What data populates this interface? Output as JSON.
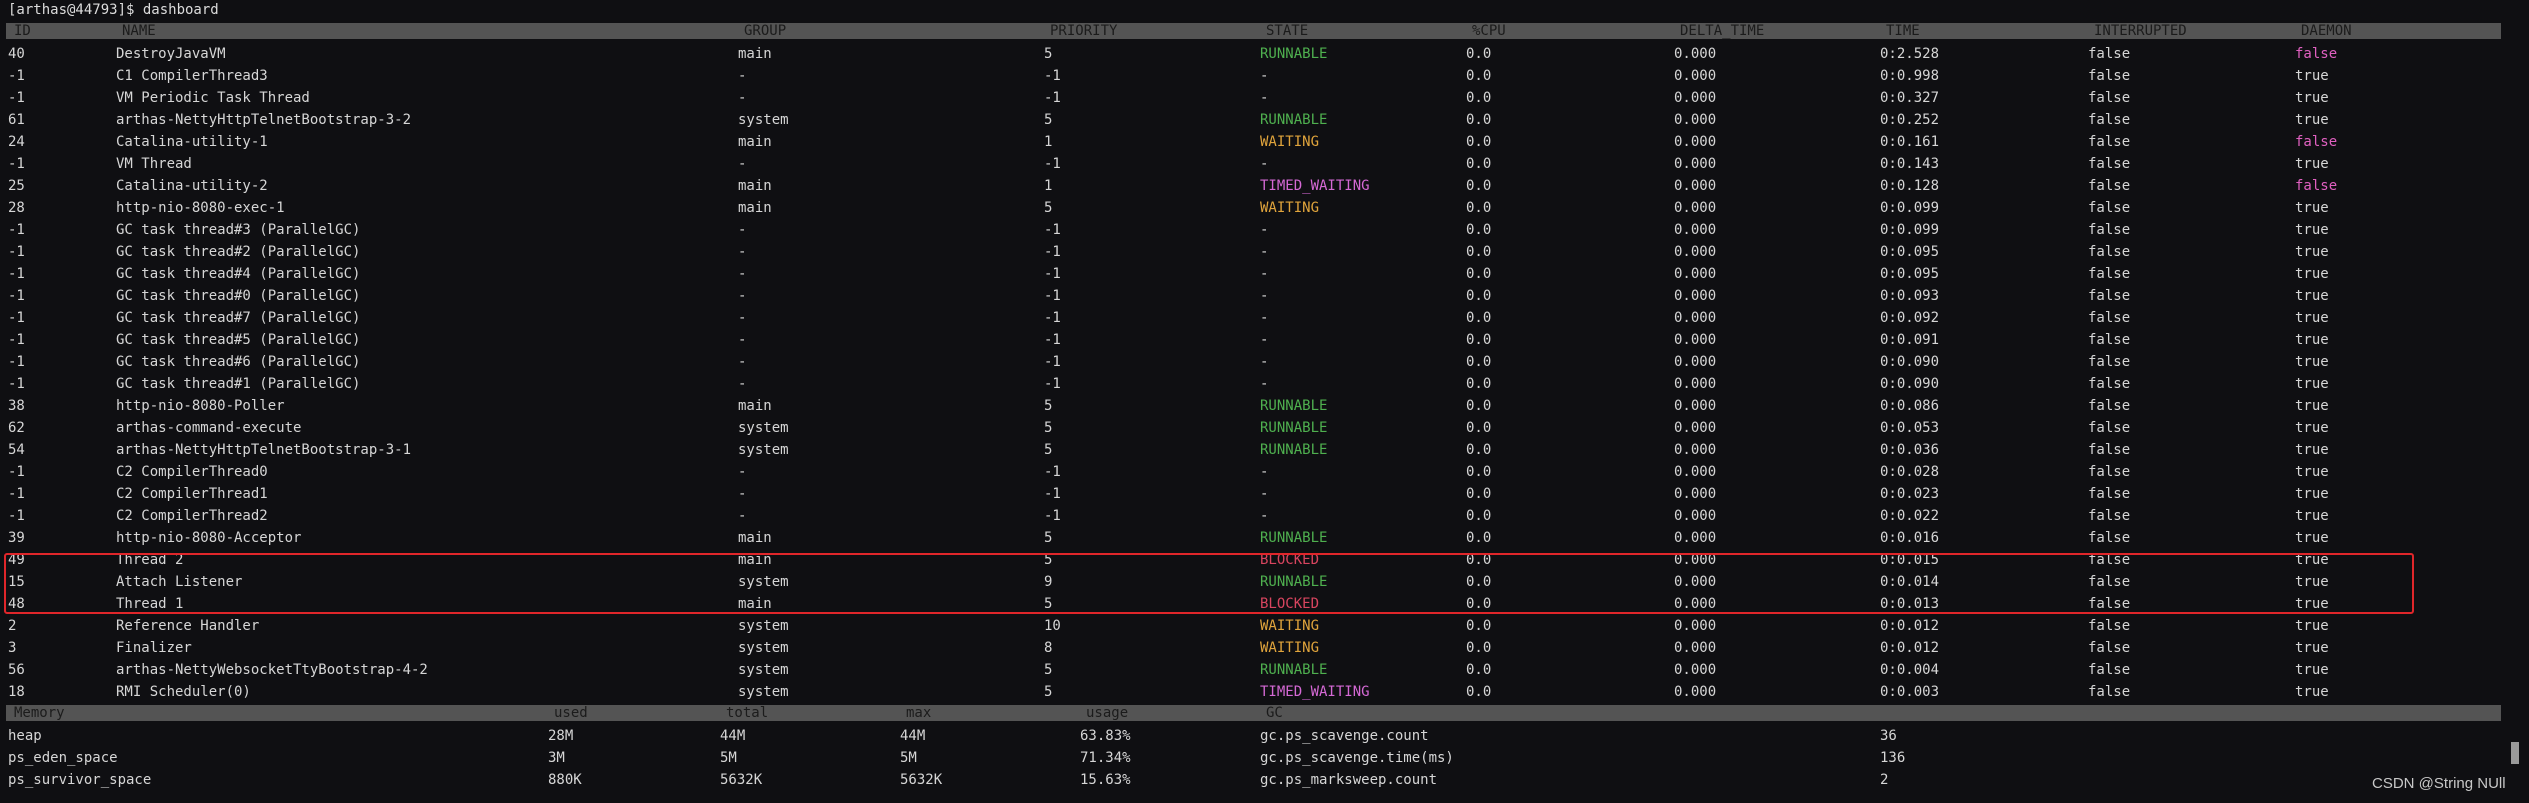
{
  "prompt": "[arthas@44793]$ dashboard",
  "colors": {
    "RUNNABLE": "#4fb04f",
    "WAITING": "#e0a43c",
    "TIMED_WAITING": "#d569d5",
    "BLOCKED": "#d8455f",
    "-": "#d6d6d6",
    "daemon_false": "#e060c0",
    "daemon_true": "#d6d6d6"
  },
  "thread_headers": [
    "ID",
    "NAME",
    "GROUP",
    "PRIORITY",
    "STATE",
    "%CPU",
    "DELTA_TIME",
    "TIME",
    "INTERRUPTED",
    "DAEMON"
  ],
  "threads": [
    [
      "40",
      "DestroyJavaVM",
      "main",
      "5",
      "RUNNABLE",
      "0.0",
      "0.000",
      "0:2.528",
      "false",
      "false"
    ],
    [
      "-1",
      "C1 CompilerThread3",
      "-",
      "-1",
      "-",
      "0.0",
      "0.000",
      "0:0.998",
      "false",
      "true"
    ],
    [
      "-1",
      "VM Periodic Task Thread",
      "-",
      "-1",
      "-",
      "0.0",
      "0.000",
      "0:0.327",
      "false",
      "true"
    ],
    [
      "61",
      "arthas-NettyHttpTelnetBootstrap-3-2",
      "system",
      "5",
      "RUNNABLE",
      "0.0",
      "0.000",
      "0:0.252",
      "false",
      "true"
    ],
    [
      "24",
      "Catalina-utility-1",
      "main",
      "1",
      "WAITING",
      "0.0",
      "0.000",
      "0:0.161",
      "false",
      "false"
    ],
    [
      "-1",
      "VM Thread",
      "-",
      "-1",
      "-",
      "0.0",
      "0.000",
      "0:0.143",
      "false",
      "true"
    ],
    [
      "25",
      "Catalina-utility-2",
      "main",
      "1",
      "TIMED_WAITING",
      "0.0",
      "0.000",
      "0:0.128",
      "false",
      "false"
    ],
    [
      "28",
      "http-nio-8080-exec-1",
      "main",
      "5",
      "WAITING",
      "0.0",
      "0.000",
      "0:0.099",
      "false",
      "true"
    ],
    [
      "-1",
      "GC task thread#3 (ParallelGC)",
      "-",
      "-1",
      "-",
      "0.0",
      "0.000",
      "0:0.099",
      "false",
      "true"
    ],
    [
      "-1",
      "GC task thread#2 (ParallelGC)",
      "-",
      "-1",
      "-",
      "0.0",
      "0.000",
      "0:0.095",
      "false",
      "true"
    ],
    [
      "-1",
      "GC task thread#4 (ParallelGC)",
      "-",
      "-1",
      "-",
      "0.0",
      "0.000",
      "0:0.095",
      "false",
      "true"
    ],
    [
      "-1",
      "GC task thread#0 (ParallelGC)",
      "-",
      "-1",
      "-",
      "0.0",
      "0.000",
      "0:0.093",
      "false",
      "true"
    ],
    [
      "-1",
      "GC task thread#7 (ParallelGC)",
      "-",
      "-1",
      "-",
      "0.0",
      "0.000",
      "0:0.092",
      "false",
      "true"
    ],
    [
      "-1",
      "GC task thread#5 (ParallelGC)",
      "-",
      "-1",
      "-",
      "0.0",
      "0.000",
      "0:0.091",
      "false",
      "true"
    ],
    [
      "-1",
      "GC task thread#6 (ParallelGC)",
      "-",
      "-1",
      "-",
      "0.0",
      "0.000",
      "0:0.090",
      "false",
      "true"
    ],
    [
      "-1",
      "GC task thread#1 (ParallelGC)",
      "-",
      "-1",
      "-",
      "0.0",
      "0.000",
      "0:0.090",
      "false",
      "true"
    ],
    [
      "38",
      "http-nio-8080-Poller",
      "main",
      "5",
      "RUNNABLE",
      "0.0",
      "0.000",
      "0:0.086",
      "false",
      "true"
    ],
    [
      "62",
      "arthas-command-execute",
      "system",
      "5",
      "RUNNABLE",
      "0.0",
      "0.000",
      "0:0.053",
      "false",
      "true"
    ],
    [
      "54",
      "arthas-NettyHttpTelnetBootstrap-3-1",
      "system",
      "5",
      "RUNNABLE",
      "0.0",
      "0.000",
      "0:0.036",
      "false",
      "true"
    ],
    [
      "-1",
      "C2 CompilerThread0",
      "-",
      "-1",
      "-",
      "0.0",
      "0.000",
      "0:0.028",
      "false",
      "true"
    ],
    [
      "-1",
      "C2 CompilerThread1",
      "-",
      "-1",
      "-",
      "0.0",
      "0.000",
      "0:0.023",
      "false",
      "true"
    ],
    [
      "-1",
      "C2 CompilerThread2",
      "-",
      "-1",
      "-",
      "0.0",
      "0.000",
      "0:0.022",
      "false",
      "true"
    ],
    [
      "39",
      "http-nio-8080-Acceptor",
      "main",
      "5",
      "RUNNABLE",
      "0.0",
      "0.000",
      "0:0.016",
      "false",
      "true"
    ],
    [
      "49",
      "Thread 2",
      "main",
      "5",
      "BLOCKED",
      "0.0",
      "0.000",
      "0:0.015",
      "false",
      "true"
    ],
    [
      "15",
      "Attach Listener",
      "system",
      "9",
      "RUNNABLE",
      "0.0",
      "0.000",
      "0:0.014",
      "false",
      "true"
    ],
    [
      "48",
      "Thread 1",
      "main",
      "5",
      "BLOCKED",
      "0.0",
      "0.000",
      "0:0.013",
      "false",
      "true"
    ],
    [
      "2",
      "Reference Handler",
      "system",
      "10",
      "WAITING",
      "0.0",
      "0.000",
      "0:0.012",
      "false",
      "true"
    ],
    [
      "3",
      "Finalizer",
      "system",
      "8",
      "WAITING",
      "0.0",
      "0.000",
      "0:0.012",
      "false",
      "true"
    ],
    [
      "56",
      "arthas-NettyWebsocketTtyBootstrap-4-2",
      "system",
      "5",
      "RUNNABLE",
      "0.0",
      "0.000",
      "0:0.004",
      "false",
      "true"
    ],
    [
      "18",
      "RMI Scheduler(0)",
      "system",
      "5",
      "TIMED_WAITING",
      "0.0",
      "0.000",
      "0:0.003",
      "false",
      "true"
    ]
  ],
  "memory_headers": [
    "Memory",
    "used",
    "total",
    "max",
    "usage",
    "GC",
    ""
  ],
  "memory": [
    [
      "heap",
      "28M",
      "44M",
      "44M",
      "63.83%",
      "gc.ps_scavenge.count",
      "36"
    ],
    [
      "ps_eden_space",
      "3M",
      "5M",
      "5M",
      "71.34%",
      "gc.ps_scavenge.time(ms)",
      "136"
    ],
    [
      "ps_survivor_space",
      "880K",
      "5632K",
      "5632K",
      "15.63%",
      "gc.ps_marksweep.count",
      "2"
    ]
  ],
  "watermark": "CSDN @String NUll"
}
